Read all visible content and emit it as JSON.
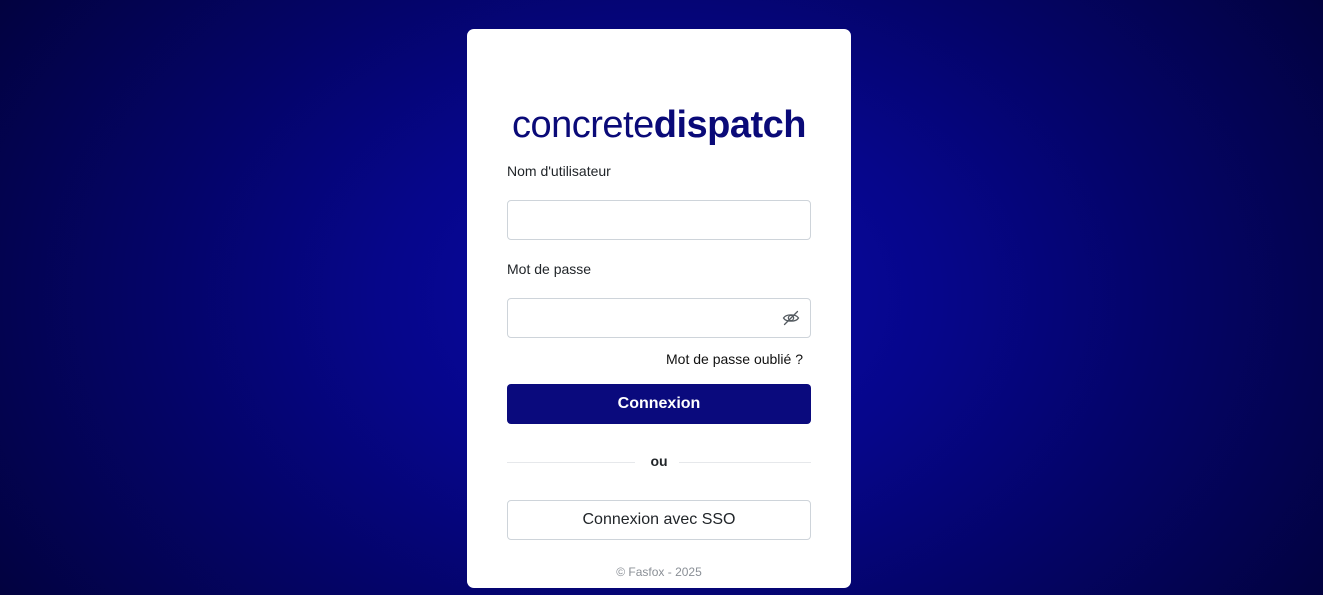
{
  "brand": {
    "logo_light": "concrete",
    "logo_bold": "dispatch",
    "color": "#0a0a78"
  },
  "form": {
    "username_label": "Nom d'utilisateur",
    "username_value": "",
    "password_label": "Mot de passe",
    "password_value": "",
    "password_toggle_icon": "eye-slash-icon",
    "forgot_link": "Mot de passe oublié ?",
    "submit_label": "Connexion",
    "divider_text": "ou",
    "sso_label": "Connexion avec SSO"
  },
  "footer": {
    "copyright": "© Fasfox - 2025"
  },
  "colors": {
    "primary": "#0a0a7d",
    "background": "#06068a"
  }
}
